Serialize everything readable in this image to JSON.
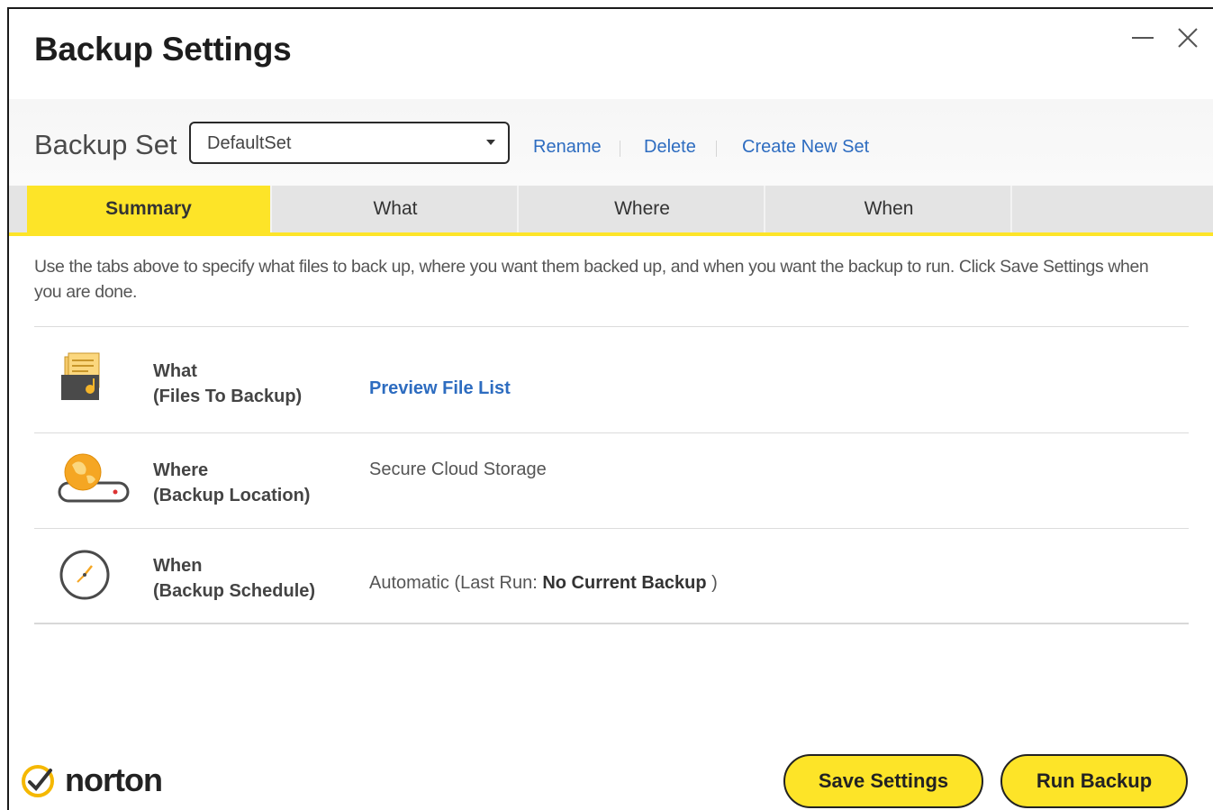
{
  "window": {
    "title": "Backup Settings",
    "minimize_label": "minimize",
    "close_label": "close"
  },
  "backup_set": {
    "label": "Backup Set",
    "selected": "DefaultSet",
    "links": {
      "rename": "Rename",
      "delete": "Delete",
      "create": "Create New Set"
    }
  },
  "tabs": [
    {
      "label": "Summary",
      "active": true
    },
    {
      "label": "What",
      "active": false
    },
    {
      "label": "Where",
      "active": false
    },
    {
      "label": "When",
      "active": false
    }
  ],
  "intro_text": "Use the tabs above to specify what files to back up, where you want them backed up, and when you want the backup to run. Click Save Settings when you are done.",
  "rows": {
    "what": {
      "title": "What",
      "subtitle": "(Files To Backup)",
      "link": "Preview File List",
      "icon": "files-folder-icon"
    },
    "where": {
      "title": "Where",
      "subtitle": "(Backup Location)",
      "value": "Secure Cloud Storage",
      "icon": "cloud-drive-icon"
    },
    "when": {
      "title": "When",
      "subtitle": "(Backup Schedule)",
      "value_prefix": "Automatic (Last Run: ",
      "value_bold": "No Current Backup",
      "value_suffix": " )",
      "icon": "clock-icon"
    }
  },
  "footer": {
    "logo_text": "norton",
    "save_label": "Save Settings",
    "run_label": "Run Backup"
  },
  "colors": {
    "accent_yellow": "#fde428",
    "link_blue": "#2d6cc0"
  }
}
